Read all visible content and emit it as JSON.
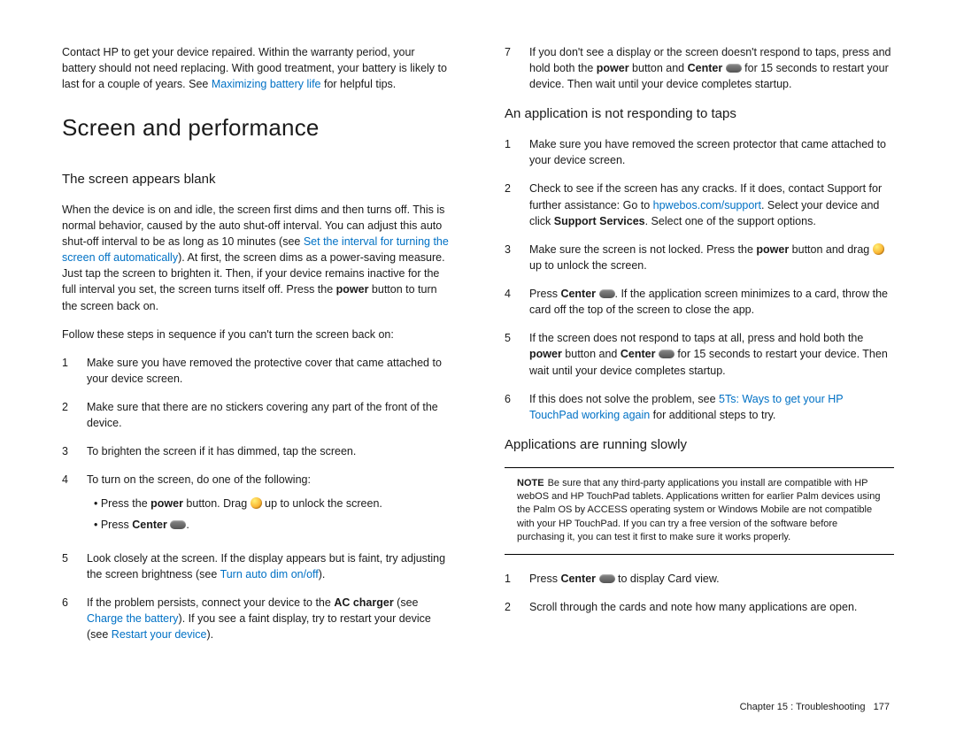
{
  "left": {
    "intro_a": "Contact HP to get your device repaired. Within the warranty period, your battery should not need replacing. With good treatment, your battery is likely to last for a couple of years. See ",
    "intro_link": "Maximizing battery life",
    "intro_b": " for helpful tips.",
    "h1": "Screen and performance",
    "h2_blank": "The screen appears blank",
    "blank_p1_a": "When the device is on and idle, the screen first dims and then turns off. This is normal behavior, caused by the auto shut-off interval. You can adjust this auto shut-off interval to be as long as 10 minutes (see ",
    "blank_p1_link": "Set the interval for turning the screen off automatically",
    "blank_p1_b": "). At first, the screen dims as a power-saving measure. Just tap the screen to brighten it. Then, if your device remains inactive for the full interval you set, the screen turns itself off. Press the ",
    "blank_p1_bold": "power",
    "blank_p1_c": " button to turn the screen back on.",
    "blank_p2": "Follow these steps in sequence if you can't turn the screen back on:",
    "steps": [
      "Make sure you have removed the protective cover that came attached to your device screen.",
      "Make sure that there are no stickers covering any part of the front of the device.",
      "To brighten the screen if it has dimmed, tap the screen.",
      "To turn on the screen, do one of the following:"
    ],
    "bullet4a_a": "• Press the ",
    "bullet4a_bold": "power",
    "bullet4a_b": " button. Drag ",
    "bullet4a_c": " up to unlock the screen.",
    "bullet4b_a": "• Press ",
    "bullet4b_bold": "Center",
    "bullet4b_b": " ",
    "bullet4b_c": ".",
    "step5_a": "Look closely at the screen. If the display appears but is faint, try adjusting the screen brightness (see ",
    "step5_link": "Turn auto dim on/off",
    "step5_b": ").",
    "step6_a": "If the problem persists, connect your device to the ",
    "step6_bold": "AC charger",
    "step6_b": " (see ",
    "step6_link1": "Charge the battery",
    "step6_c": "). If you see a faint display, try to restart your device (see ",
    "step6_link2": "Restart your device",
    "step6_d": ")."
  },
  "right": {
    "step7_a": "If you don't see a display or the screen doesn't respond to taps, press and hold both the ",
    "step7_bold1": "power",
    "step7_b": " button and ",
    "step7_bold2": "Center",
    "step7_c": " ",
    "step7_d": " for 15 seconds to restart your device. Then wait until your device completes startup.",
    "h2_app": "An application is not responding to taps",
    "app_steps": {
      "s1": "Make sure you have removed the screen protector that came attached to your device screen.",
      "s2a": "Check to see if the screen has any cracks. If it does, contact Support for further assistance: Go to ",
      "s2link": "hpwebos.com/support",
      "s2b": ". Select your device and click ",
      "s2bold": "Support Services",
      "s2c": ". Select one of the support options.",
      "s3a": "Make sure the screen is not locked. Press the ",
      "s3bold": "power",
      "s3b": " button and drag ",
      "s3c": " up to unlock the screen.",
      "s4a": "Press ",
      "s4bold": "Center",
      "s4b": " ",
      "s4c": ". If the application screen minimizes to a card, throw the card off the top of the screen to close the app.",
      "s5a": "If the screen does not respond to taps at all, press and hold both the ",
      "s5bold1": "power",
      "s5b": " button and ",
      "s5bold2": "Center",
      "s5c": " ",
      "s5d": " for 15 seconds to restart your device. Then wait until your device completes startup.",
      "s6a": "If this does not solve the problem, see ",
      "s6link": "5Ts: Ways to get your HP TouchPad working again",
      "s6b": " for additional steps to try."
    },
    "h2_slow": "Applications are running slowly",
    "note_label": "NOTE",
    "note_text": "Be sure that any third-party applications you install are compatible with HP webOS and HP TouchPad tablets. Applications written for earlier Palm devices using the Palm OS by ACCESS operating system or Windows Mobile are not compatible with your HP TouchPad. If you can try a free version of the software before purchasing it, you can test it first to make sure it works properly.",
    "slow1a": "Press ",
    "slow1bold": "Center",
    "slow1b": " ",
    "slow1c": " to display Card view.",
    "slow2": "Scroll through the cards and note how many applications are open."
  },
  "footer": {
    "chapter": "Chapter 15 : Troubleshooting",
    "page": "177"
  }
}
